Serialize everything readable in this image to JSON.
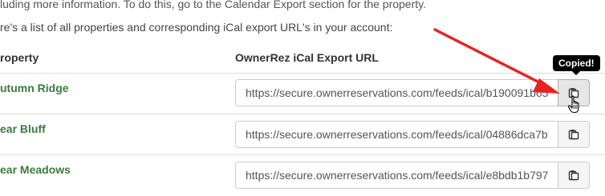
{
  "intro": {
    "line1": "luding more information. To do this, go to the Calendar Export section for the property.",
    "line2": "re's a list of all properties and corresponding iCal export URL's in your account:"
  },
  "table": {
    "header_property": "roperty",
    "header_url": "OwnerRez iCal Export URL",
    "rows": [
      {
        "name": "utumn Ridge",
        "url": "https://secure.ownerreservations.com/feeds/ical/b190091b65"
      },
      {
        "name": "ear Bluff",
        "url": "https://secure.ownerreservations.com/feeds/ical/04886dca7b"
      },
      {
        "name": "ear Meadows",
        "url": "https://secure.ownerreservations.com/feeds/ical/e8bdb1b797"
      }
    ]
  },
  "tooltip": {
    "text": "Copied!"
  },
  "icons": {
    "copy": "clipboard-copy-icon",
    "cursor": "hand-pointer-cursor",
    "annotation": "red-arrow"
  },
  "colors": {
    "property_link": "#3d7a3f",
    "annotation_arrow": "#e8231f",
    "tooltip_bg": "#000000"
  }
}
